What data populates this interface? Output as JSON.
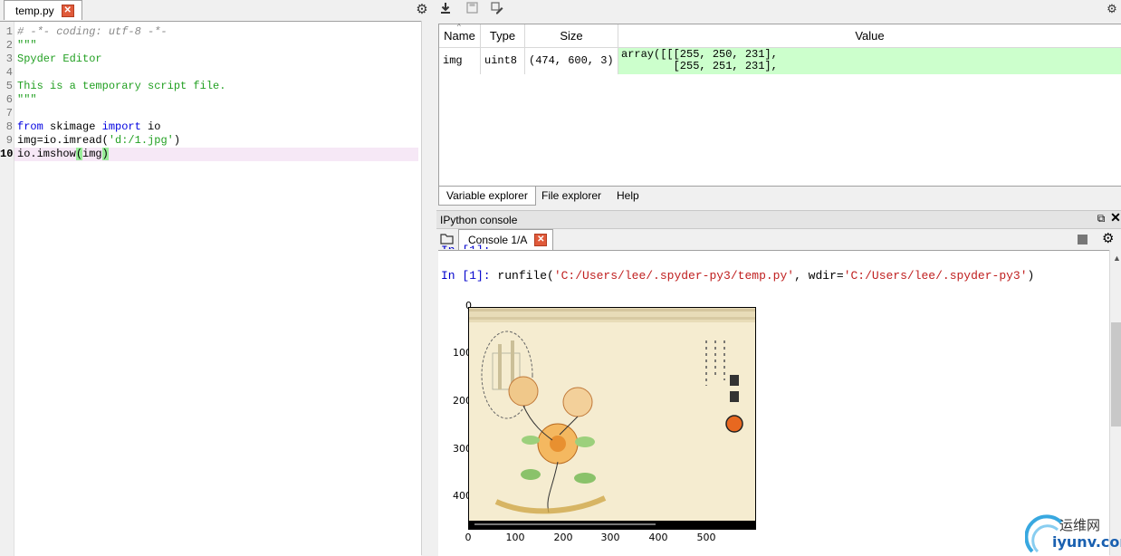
{
  "editor": {
    "tab_label": "temp.py",
    "close_glyph": "✕",
    "gear_icon": "gear-icon",
    "line_numbers": [
      "1",
      "2",
      "3",
      "4",
      "5",
      "6",
      "7",
      "8",
      "9",
      "10"
    ],
    "code": {
      "l1": "# -*- coding: utf-8 -*-",
      "l2": "\"\"\"",
      "l3": "Spyder Editor",
      "l5": "This is a temporary script file.",
      "l6": "\"\"\"",
      "l8_from": "from",
      "l8_mid": " skimage ",
      "l8_import": "import",
      "l8_end": " io",
      "l9_start": "img=io.imread(",
      "l9_str": "'d:/1.jpg'",
      "l9_end": ")",
      "l10_start": "io.imshow",
      "l10_open": "(",
      "l10_arg": "img",
      "l10_close": ")"
    }
  },
  "variable_explorer": {
    "columns": [
      "Name",
      "Type",
      "Size",
      "Value"
    ],
    "rows": [
      {
        "name": "img",
        "type": "uint8",
        "size": "(474, 600, 3)",
        "value": "array([[[255, 250, 231],\n        [255, 251, 231],"
      }
    ],
    "bottom_tabs": [
      "Variable explorer",
      "File explorer",
      "Help"
    ]
  },
  "ipython": {
    "pane_title": "IPython console",
    "console_tab": "Console 1/A",
    "prompt": "In [1]:",
    "cmd_start": " runfile(",
    "cmd_str1": "'C:/Users/lee/.spyder-py3/temp.py'",
    "cmd_mid": ", wdir=",
    "cmd_str2": "'C:/Users/lee/.spyder-py3'",
    "cmd_end": ")",
    "partial_prev_line": "In [1]:",
    "plot": {
      "y_ticks": [
        "0",
        "100",
        "200",
        "300",
        "400"
      ],
      "x_ticks": [
        "0",
        "100",
        "200",
        "300",
        "400",
        "500"
      ]
    }
  },
  "watermark": {
    "cn": "运维网",
    "site": "iyunv.com"
  },
  "colors": {
    "value_cell": "#ccffcc",
    "current_line": "#f6e8f6",
    "close_button": "#e05a3a"
  }
}
